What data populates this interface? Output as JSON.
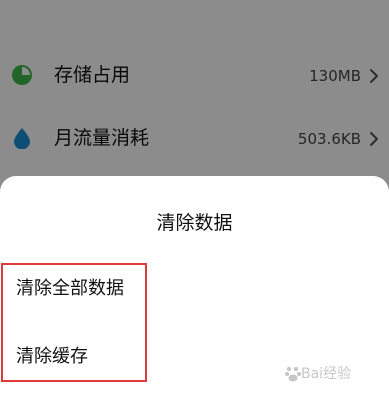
{
  "settings": {
    "rows": [
      {
        "label": "存储占用",
        "value": "130MB",
        "icon": "pie-chart-icon",
        "icon_color": "#3db84a"
      },
      {
        "label": "月流量消耗",
        "value": "503.6KB",
        "icon": "water-drop-icon",
        "icon_color": "#1a8fd6"
      }
    ]
  },
  "dialog": {
    "title": "清除数据",
    "options": [
      {
        "label": "清除全部数据"
      },
      {
        "label": "清除缓存"
      }
    ]
  },
  "watermark": {
    "text": "Bai经验"
  },
  "colors": {
    "highlight": "#e23a3a",
    "scrim": "rgba(0,0,0,0.45)"
  }
}
